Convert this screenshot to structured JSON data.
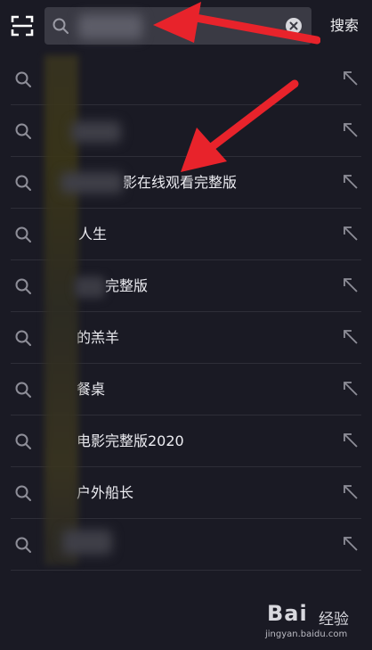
{
  "header": {
    "search_query": "",
    "search_button_label": "搜索",
    "scan_icon": "scan-icon",
    "search_icon": "search-icon",
    "clear_icon": "clear-icon"
  },
  "suggestions": [
    {
      "text": ""
    },
    {
      "text": ""
    },
    {
      "text": "影在线观看完整版"
    },
    {
      "text": "人生"
    },
    {
      "text": "完整版"
    },
    {
      "text": "的羔羊"
    },
    {
      "text": "餐桌"
    },
    {
      "text": "电影完整版2020"
    },
    {
      "text": "户外船长"
    },
    {
      "text": ""
    }
  ],
  "row_icons": {
    "left": "search-icon",
    "right": "fill-query-arrow-icon"
  },
  "watermark": {
    "logo": "Bai",
    "logo_suffix": "经验",
    "url": "jingyan.baidu.com"
  },
  "colors": {
    "background": "#1a1a24",
    "search_box": "#3a3a44",
    "divider": "#2e2e38",
    "arrow": "#e8232b"
  }
}
